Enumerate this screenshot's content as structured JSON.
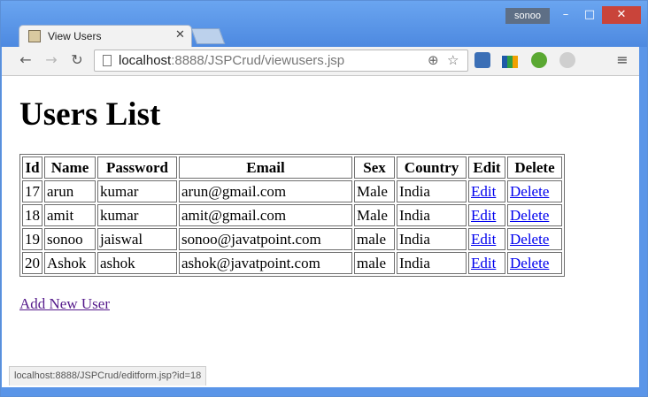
{
  "window": {
    "profile_name": "sonoo",
    "minimize_glyph": "–",
    "maximize_glyph": "□",
    "close_glyph": "✕"
  },
  "tab": {
    "title": "View Users",
    "close_glyph": "✕"
  },
  "toolbar": {
    "back_glyph": "←",
    "forward_glyph": "→",
    "reload_glyph": "↻",
    "url_host": "localhost",
    "url_path": ":8888/JSPCrud/viewusers.jsp",
    "zoom_glyph": "⊕",
    "star_glyph": "☆",
    "menu_glyph": "≡",
    "extensions": [
      "ext-a-icon",
      "ext-chart-icon",
      "ext-green-icon",
      "ext-m-icon",
      "ext-faded-icon"
    ]
  },
  "page": {
    "heading": "Users List",
    "columns": [
      "Id",
      "Name",
      "Password",
      "Email",
      "Sex",
      "Country",
      "Edit",
      "Delete"
    ],
    "rows": [
      {
        "id": "17",
        "name": "arun",
        "password": "kumar",
        "email": "arun@gmail.com",
        "sex": "Male",
        "country": "India",
        "edit": "Edit",
        "delete": "Delete"
      },
      {
        "id": "18",
        "name": "amit",
        "password": "kumar",
        "email": "amit@gmail.com",
        "sex": "Male",
        "country": "India",
        "edit": "Edit",
        "delete": "Delete"
      },
      {
        "id": "19",
        "name": "sonoo",
        "password": "jaiswal",
        "email": "sonoo@javatpoint.com",
        "sex": "male",
        "country": "India",
        "edit": "Edit",
        "delete": "Delete"
      },
      {
        "id": "20",
        "name": "Ashok",
        "password": "ashok",
        "email": "ashok@javatpoint.com",
        "sex": "male",
        "country": "India",
        "edit": "Edit",
        "delete": "Delete"
      }
    ],
    "add_link": "Add New User"
  },
  "status_bar": {
    "text": "localhost:8888/JSPCrud/editform.jsp?id=18"
  },
  "colors": {
    "link": "#0000ee",
    "visited_link": "#551a8b",
    "close_button": "#c9443a",
    "window_frame": "#5a95e8"
  }
}
